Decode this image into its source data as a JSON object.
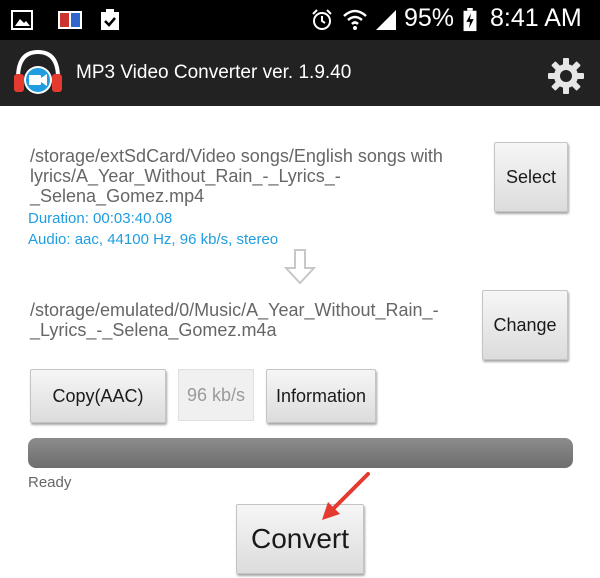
{
  "status_bar": {
    "battery_percent": "95%",
    "time": "8:41 AM",
    "icons": [
      "image-icon",
      "book-icon",
      "clipboard-check-icon",
      "alarm-icon",
      "wifi-icon",
      "signal-icon",
      "battery-charging-icon"
    ]
  },
  "app_bar": {
    "title": "MP3 Video Converter ver. 1.9.40",
    "logo_icon": "headphones-video-logo-icon",
    "settings_icon": "gear-icon"
  },
  "source": {
    "path_lines": [
      "/storage/extSdCard/Video songs/English songs with",
      "lyrics/A_Year_Without_Rain_-_Lyrics_-",
      "_Selena_Gomez.mp4"
    ],
    "duration": "Duration: 00:03:40.08",
    "audio": "Audio: aac, 44100 Hz, 96 kb/s, stereo",
    "select_label": "Select"
  },
  "output": {
    "path_lines": [
      "/storage/emulated/0/Music/A_Year_Without_Rain_-",
      "_Lyrics_-_Selena_Gomez.m4a"
    ],
    "change_label": "Change"
  },
  "options": {
    "format_label": "Copy(AAC)",
    "bitrate": "96 kb/s",
    "information_label": "Information"
  },
  "progress": {
    "fraction": 0,
    "status": "Ready"
  },
  "convert_label": "Convert",
  "colors": {
    "app_bar": "#222222",
    "accent_blue": "#1f9de0",
    "annotation_arrow": "#e53a2f"
  }
}
